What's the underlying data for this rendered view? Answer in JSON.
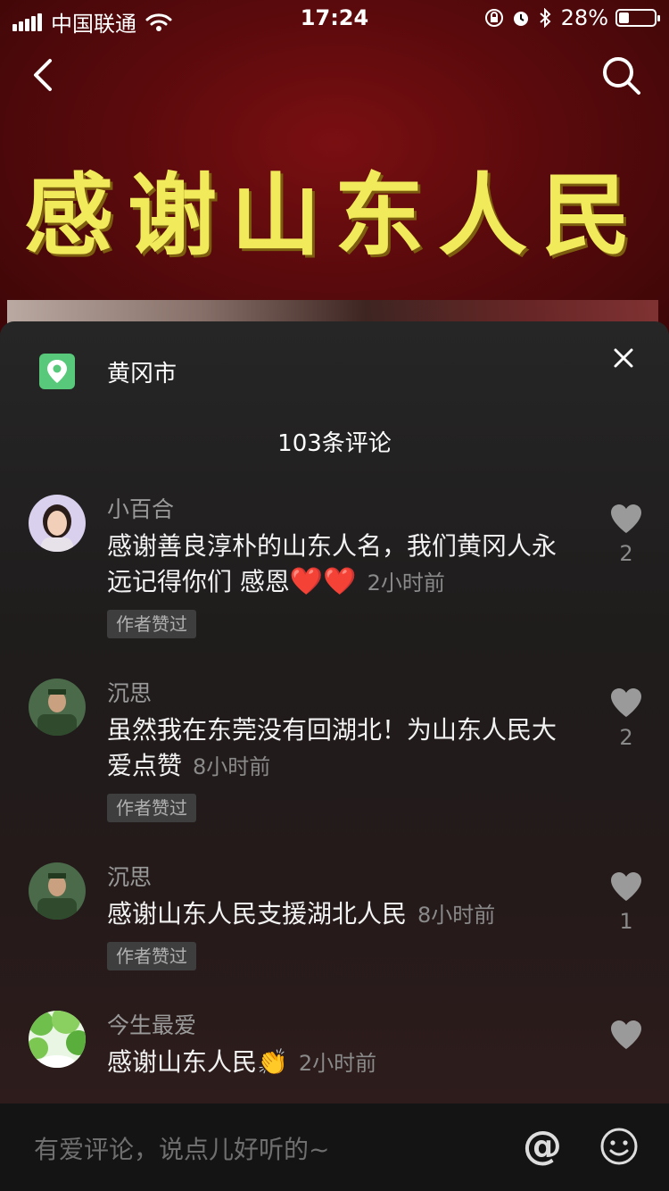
{
  "status_bar": {
    "carrier": "中国联通",
    "time": "17:24",
    "battery_percent": "28%",
    "battery_level": 0.28
  },
  "video": {
    "banner_text": "感谢山东人民"
  },
  "sheet": {
    "location": "黄冈市",
    "comment_count_label": "103条评论",
    "comments": [
      {
        "username": "小百合",
        "text": "感谢善良淳朴的山东人名，我们黄冈人永远记得你们 感恩",
        "emoji": "❤️❤️",
        "time": "2小时前",
        "badge": "作者赞过",
        "likes": "2"
      },
      {
        "username": "沉思",
        "text": "虽然我在东莞没有回湖北！为山东人民大爱点赞",
        "time": "8小时前",
        "badge": "作者赞过",
        "likes": "2"
      },
      {
        "username": "沉思",
        "text": "感谢山东人民支援湖北人民",
        "time": "8小时前",
        "badge": "作者赞过",
        "likes": "1"
      },
      {
        "username": "今生最爱",
        "text": "感谢山东人民",
        "emoji": "👏",
        "time": "2小时前",
        "likes": ""
      }
    ]
  },
  "input_bar": {
    "placeholder": "有爱评论，说点儿好听的~",
    "at_label": "@"
  },
  "colors": {
    "accent_green": "#58c97a",
    "banner_yellow": "#f1ea5b",
    "video_red": "#7a0f12",
    "sheet_bg": "#262626"
  },
  "icons": [
    "signal-icon",
    "wifi-icon",
    "lock-rotation-icon",
    "alarm-icon",
    "bluetooth-icon",
    "battery-icon",
    "back-icon",
    "search-icon",
    "location-pin-icon",
    "close-icon",
    "heart-icon",
    "at-icon",
    "emoji-icon"
  ]
}
